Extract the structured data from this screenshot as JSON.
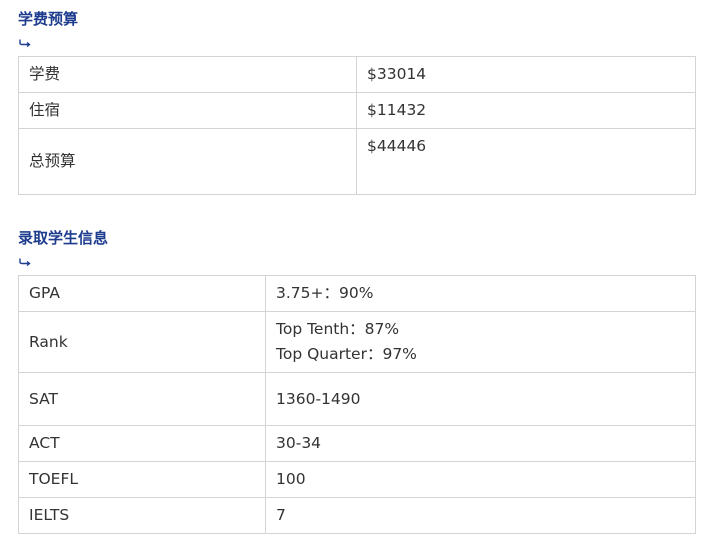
{
  "tuition_section": {
    "title": "学费预算",
    "rows": [
      {
        "label": "学费",
        "value": "$33014"
      },
      {
        "label": "住宿",
        "value": "$11432"
      },
      {
        "label": "总预算",
        "value": "$44446"
      }
    ]
  },
  "admission_section": {
    "title": "录取学生信息",
    "rows": [
      {
        "label": "GPA",
        "value": "3.75+：90%"
      },
      {
        "label": "Rank",
        "value_lines": [
          "Top Tenth：87%",
          "Top Quarter：97%"
        ]
      },
      {
        "label": "SAT",
        "value": "1360-1490"
      },
      {
        "label": "ACT",
        "value": "30-34"
      },
      {
        "label": "TOEFL",
        "value": "100"
      },
      {
        "label": "IELTS",
        "value": "7"
      }
    ]
  },
  "icons": {
    "section_marker": "return-arrow-icon"
  },
  "colors": {
    "title": "#1f3d8f",
    "border": "#d4d4d4",
    "text": "#333333"
  }
}
